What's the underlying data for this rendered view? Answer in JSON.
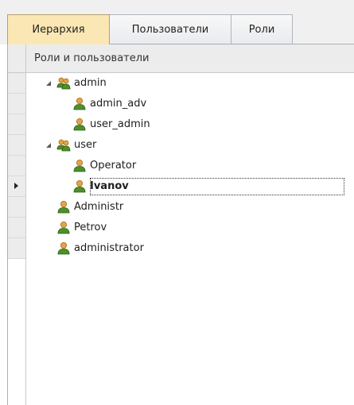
{
  "tabs": [
    {
      "label": "Иерархия",
      "active": true
    },
    {
      "label": "Пользователи",
      "active": false
    },
    {
      "label": "Роли",
      "active": false
    }
  ],
  "grid": {
    "column_header": "Роли и пользователи",
    "selected_row": "Ivanov"
  },
  "tree": [
    {
      "label": "admin",
      "type": "group",
      "icon": "group-icon",
      "expanded": true
    },
    {
      "label": "admin_adv",
      "type": "user",
      "icon": "user-icon"
    },
    {
      "label": "user_admin",
      "type": "user",
      "icon": "user-icon"
    },
    {
      "label": "user",
      "type": "group",
      "icon": "group-icon",
      "expanded": true
    },
    {
      "label": "Operator",
      "type": "user",
      "icon": "user-icon"
    },
    {
      "label": "Ivanov",
      "type": "user",
      "icon": "user-icon",
      "selected": true
    },
    {
      "label": "Administr",
      "type": "user",
      "icon": "user-icon"
    },
    {
      "label": "Petrov",
      "type": "user",
      "icon": "user-icon"
    },
    {
      "label": "administrator",
      "type": "user",
      "icon": "user-icon"
    }
  ],
  "colors": {
    "active_tab": "#fbe7b4",
    "header_bg": "#ececec",
    "grid_line": "#c6cacf",
    "user_icon_green": "#4f8f2a",
    "user_icon_orange": "#e6a540"
  }
}
